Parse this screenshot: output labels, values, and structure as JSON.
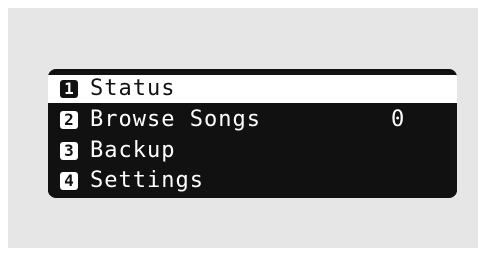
{
  "menu": {
    "items": [
      {
        "number": "1",
        "label": "Status",
        "value": "",
        "selected": true
      },
      {
        "number": "2",
        "label": "Browse Songs",
        "value": "0",
        "selected": false
      },
      {
        "number": "3",
        "label": "Backup",
        "value": "",
        "selected": false
      },
      {
        "number": "4",
        "label": "Settings",
        "value": "",
        "selected": false
      }
    ]
  },
  "colors": {
    "screen_background": "#111111",
    "highlight": "#ffffff",
    "outer_panel": "#e6e6e6"
  }
}
